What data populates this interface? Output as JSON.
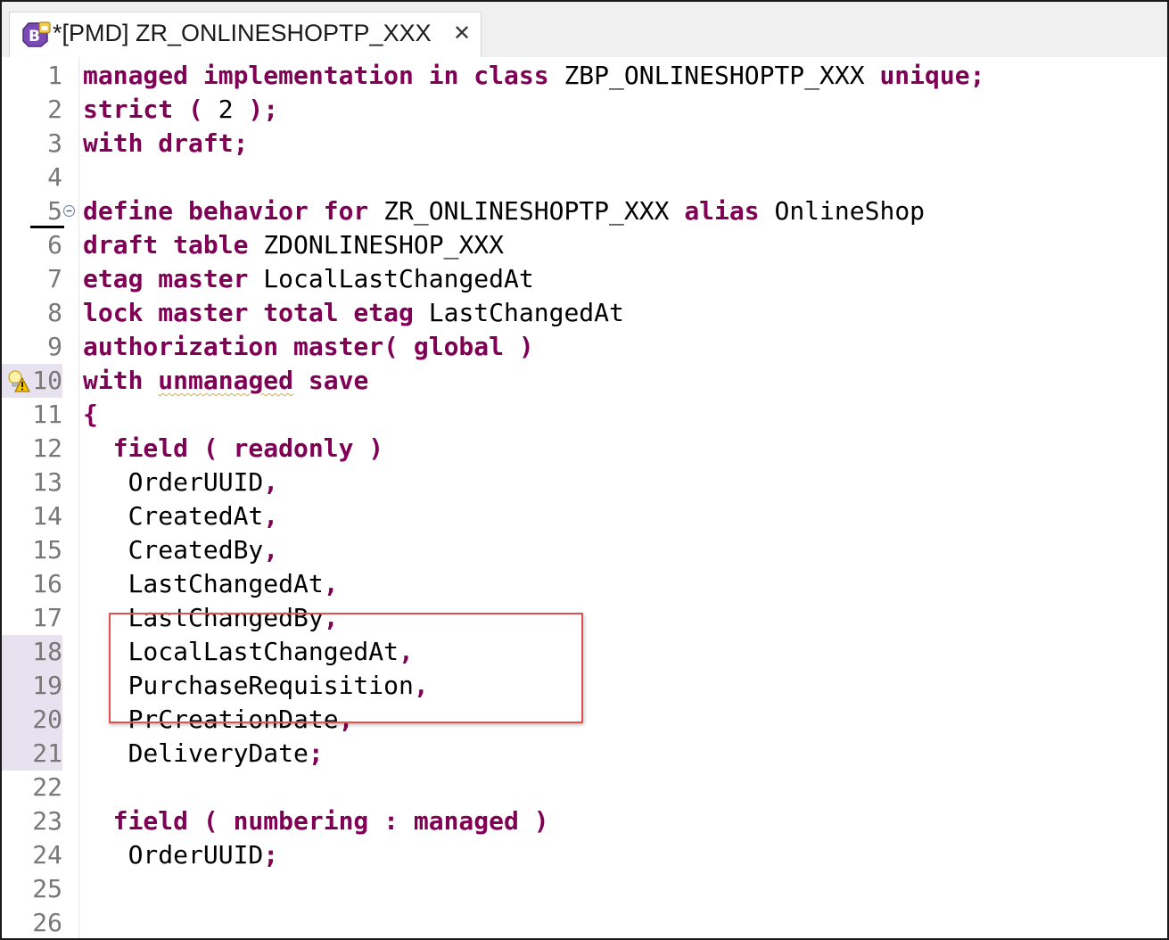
{
  "tab": {
    "title": "*[PMD] ZR_ONLINESHOPTP_XXX",
    "icon": "behavior-definition-icon",
    "close_glyph": "✕"
  },
  "colors": {
    "keyword": "#7f0055",
    "identifier": "#000000",
    "line_number": "#787878",
    "changed_line_bg": "#e8e1ef",
    "highlight_box": "#e05252"
  },
  "lines": [
    {
      "n": "1",
      "tokens": [
        {
          "t": "managed implementation in class ",
          "c": "kw"
        },
        {
          "t": "ZBP_ONLINESHOPTP_XXX ",
          "c": "id"
        },
        {
          "t": "unique;",
          "c": "kw"
        }
      ]
    },
    {
      "n": "2",
      "tokens": [
        {
          "t": "strict ( ",
          "c": "kw"
        },
        {
          "t": "2",
          "c": "id"
        },
        {
          "t": " );",
          "c": "kw"
        }
      ]
    },
    {
      "n": "3",
      "tokens": [
        {
          "t": "with draft;",
          "c": "kw"
        }
      ]
    },
    {
      "n": "4",
      "tokens": []
    },
    {
      "n": "5",
      "fold": true,
      "caret": true,
      "tokens": [
        {
          "t": "define behavior for ",
          "c": "kw"
        },
        {
          "t": "ZR_ONLINESHOPTP_XXX ",
          "c": "id"
        },
        {
          "t": "alias ",
          "c": "kw"
        },
        {
          "t": "OnlineShop",
          "c": "id"
        }
      ]
    },
    {
      "n": "6",
      "tokens": [
        {
          "t": "draft table ",
          "c": "kw"
        },
        {
          "t": "ZDONLINESHOP_XXX",
          "c": "id"
        }
      ]
    },
    {
      "n": "7",
      "tokens": [
        {
          "t": "etag master ",
          "c": "kw"
        },
        {
          "t": "LocalLastChangedAt",
          "c": "id"
        }
      ]
    },
    {
      "n": "8",
      "tokens": [
        {
          "t": "lock master total etag ",
          "c": "kw"
        },
        {
          "t": "LastChangedAt",
          "c": "id"
        }
      ]
    },
    {
      "n": "9",
      "tokens": [
        {
          "t": "authorization master( global )",
          "c": "kw"
        }
      ]
    },
    {
      "n": "10",
      "changed": true,
      "warning": true,
      "tokens": [
        {
          "t": "with ",
          "c": "kw"
        },
        {
          "t": "unmanaged",
          "c": "kw",
          "squig": true
        },
        {
          "t": " save",
          "c": "kw"
        }
      ]
    },
    {
      "n": "11",
      "tokens": [
        {
          "t": "{",
          "c": "kw"
        }
      ]
    },
    {
      "n": "12",
      "tokens": [
        {
          "t": "  field ( readonly )",
          "c": "kw"
        }
      ]
    },
    {
      "n": "13",
      "tokens": [
        {
          "t": "   OrderUUID",
          "c": "id"
        },
        {
          "t": ",",
          "c": "punct"
        }
      ]
    },
    {
      "n": "14",
      "tokens": [
        {
          "t": "   CreatedAt",
          "c": "id"
        },
        {
          "t": ",",
          "c": "punct"
        }
      ]
    },
    {
      "n": "15",
      "tokens": [
        {
          "t": "   CreatedBy",
          "c": "id"
        },
        {
          "t": ",",
          "c": "punct"
        }
      ]
    },
    {
      "n": "16",
      "tokens": [
        {
          "t": "   LastChangedAt",
          "c": "id"
        },
        {
          "t": ",",
          "c": "punct"
        }
      ]
    },
    {
      "n": "17",
      "tokens": [
        {
          "t": "   LastChangedBy",
          "c": "id"
        },
        {
          "t": ",",
          "c": "punct"
        }
      ]
    },
    {
      "n": "18",
      "changed": true,
      "tokens": [
        {
          "t": "   LocalLastChangedAt",
          "c": "id"
        },
        {
          "t": ",",
          "c": "punct"
        }
      ]
    },
    {
      "n": "19",
      "changed": true,
      "tokens": [
        {
          "t": "   PurchaseRequisition",
          "c": "id"
        },
        {
          "t": ",",
          "c": "punct"
        }
      ]
    },
    {
      "n": "20",
      "changed": true,
      "tokens": [
        {
          "t": "   PrCreationDate",
          "c": "id"
        },
        {
          "t": ",",
          "c": "punct"
        }
      ]
    },
    {
      "n": "21",
      "changed": true,
      "tokens": [
        {
          "t": "   DeliveryDate",
          "c": "id"
        },
        {
          "t": ";",
          "c": "punct"
        }
      ]
    },
    {
      "n": "22",
      "tokens": []
    },
    {
      "n": "23",
      "tokens": [
        {
          "t": "  field ( numbering : managed )",
          "c": "kw"
        }
      ]
    },
    {
      "n": "24",
      "tokens": [
        {
          "t": "   OrderUUID",
          "c": "id"
        },
        {
          "t": ";",
          "c": "punct"
        }
      ]
    },
    {
      "n": "25",
      "tokens": []
    },
    {
      "n": "26",
      "tokens": []
    }
  ]
}
